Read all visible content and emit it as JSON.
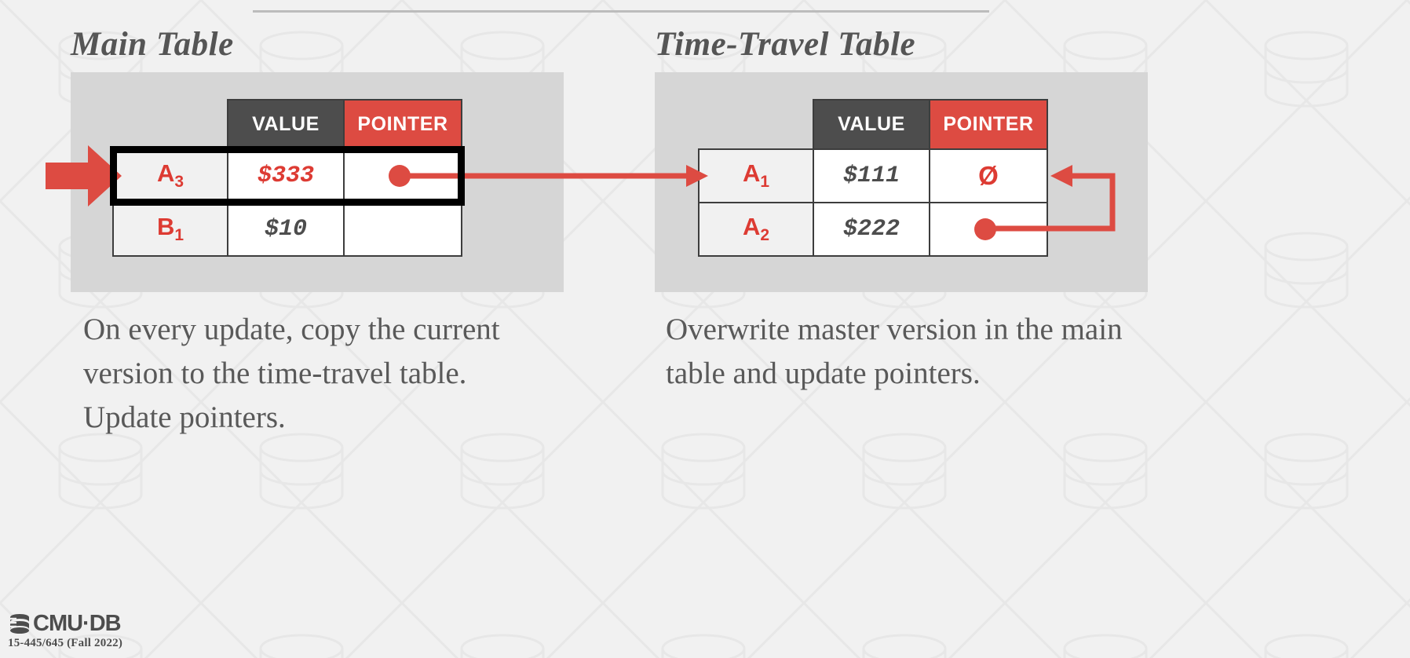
{
  "slide": {
    "background_color": "#f1f1f1",
    "panel_color": "#d6d6d6",
    "accent_red": "#dd4b42",
    "dark_gray": "#4d4d4d",
    "text_gray": "#595959"
  },
  "sections": {
    "main": {
      "title": "Main Table",
      "caption": "On every update, copy the current version to the time-travel table. Update pointers.",
      "columns": [
        "",
        "VALUE",
        "POINTER"
      ],
      "rows": [
        {
          "key": "A",
          "key_sub": "3",
          "value": "$333",
          "pointer": "dot",
          "highlighted": true
        },
        {
          "key": "B",
          "key_sub": "1",
          "value": "$10",
          "pointer": "",
          "highlighted": false
        }
      ]
    },
    "timetravel": {
      "title": "Time-Travel Table",
      "caption": "Overwrite master version in the main table and update pointers.",
      "columns": [
        "",
        "VALUE",
        "POINTER"
      ],
      "rows": [
        {
          "key": "A",
          "key_sub": "1",
          "value": "$111",
          "pointer": "null",
          "highlighted": false
        },
        {
          "key": "A",
          "key_sub": "2",
          "value": "$222",
          "pointer": "dot",
          "highlighted": false
        }
      ]
    }
  },
  "symbols": {
    "null_glyph": "Ø"
  },
  "footer": {
    "logo": "CMU·DB",
    "course": "15-445/645 (Fall 2022)"
  }
}
